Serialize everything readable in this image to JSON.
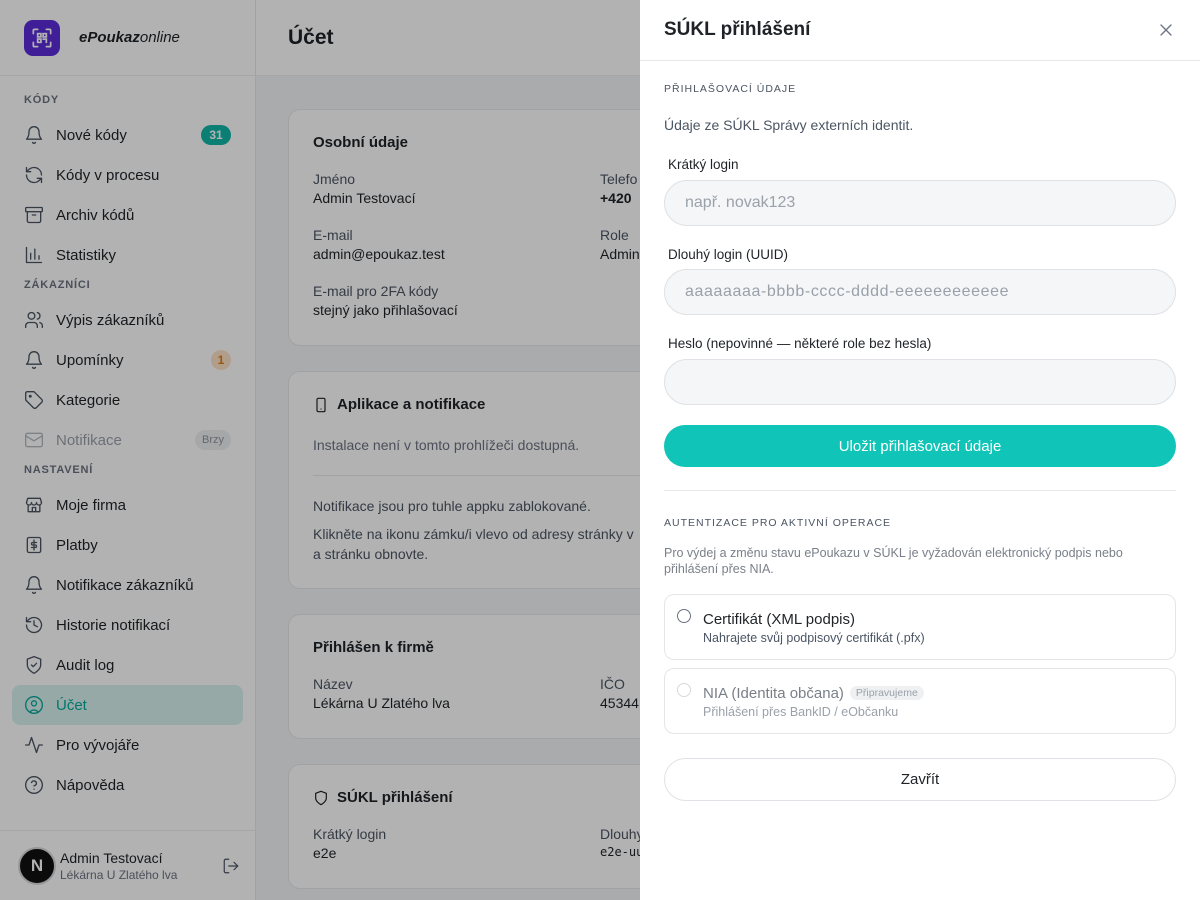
{
  "brand": {
    "name_bold": "ePoukaz",
    "name_italic": "online"
  },
  "nav": {
    "sections": {
      "codes": "KÓDY",
      "customers": "ZÁKAZNÍCI",
      "settings": "NASTAVENÍ"
    },
    "items": [
      {
        "label": "Nové kódy",
        "icon": "bell-icon",
        "badge": "31"
      },
      {
        "label": "Kódy v procesu",
        "icon": "refresh-icon"
      },
      {
        "label": "Archiv kódů",
        "icon": "archive-icon"
      },
      {
        "label": "Statistiky",
        "icon": "bar-chart-icon"
      },
      {
        "label": "Výpis zákazníků",
        "icon": "users-icon"
      },
      {
        "label": "Upomínky",
        "icon": "bell-icon",
        "badge": "1"
      },
      {
        "label": "Kategorie",
        "icon": "tag-icon"
      },
      {
        "label": "Notifikace",
        "icon": "mail-icon",
        "badge": "Brzy",
        "disabled": true
      },
      {
        "label": "Moje firma",
        "icon": "store-icon"
      },
      {
        "label": "Platby",
        "icon": "dollar-icon"
      },
      {
        "label": "Notifikace zákazníků",
        "icon": "bell-icon"
      },
      {
        "label": "Historie notifikací",
        "icon": "history-icon"
      },
      {
        "label": "Audit log",
        "icon": "shield-icon"
      },
      {
        "label": "Účet",
        "icon": "user-circle-icon",
        "active": true
      },
      {
        "label": "Pro vývojáře",
        "icon": "activity-icon"
      },
      {
        "label": "Nápověda",
        "icon": "help-icon"
      }
    ]
  },
  "user": {
    "initial": "N",
    "name": "Admin Testovací",
    "firm": "Lékárna U Zlatého lva"
  },
  "page": {
    "title": "Účet",
    "personal": {
      "title": "Osobní údaje",
      "name_label": "Jméno",
      "name_value": "Admin Testovací",
      "phone_label": "Telefo",
      "phone_value": "+420",
      "email_label": "E-mail",
      "email_value": "admin@epoukaz.test",
      "role_label": "Role",
      "role_value": "Admin",
      "email2fa_label": "E-mail pro 2FA kódy",
      "email2fa_value": "stejný jako přihlašovací"
    },
    "apps": {
      "title": "Aplikace a notifikace",
      "install_note": "Instalace není v tomto prohlížeči dostupná.",
      "blocked": "Notifikace jsou pro tuhle appku zablokované.",
      "hint_line1": "Klikněte na ikonu zámku/i vlevo od adresy stránky v",
      "hint_line2": "a stránku obnovte."
    },
    "firm": {
      "title": "Přihlášen k firmě",
      "name_label": "Název",
      "name_value": "Lékárna U Zlatého lva",
      "ico_label": "IČO",
      "ico_value": "45344"
    },
    "sukl": {
      "title": "SÚKL přihlášení",
      "short_label": "Krátký login",
      "short_value": "e2e",
      "long_label": "Dlouhy",
      "long_value": "e2e-uu"
    }
  },
  "drawer": {
    "title": "SÚKL přihlášení",
    "creds_caption": "PŘIHLAŠOVACÍ ÚDAJE",
    "creds_desc": "Údaje ze SÚKL Správy externích identit.",
    "short_label": "Krátký login",
    "short_placeholder": "např. novak123",
    "long_label": "Dlouhý login (UUID)",
    "long_placeholder": "aaaaaaaa-bbbb-cccc-dddd-eeeeeeeeeeee",
    "password_label": "Heslo (nepovinné — některé role bez hesla)",
    "password_placeholder": "",
    "save_label": "Uložit přihlašovací údaje",
    "auth_caption": "AUTENTIZACE PRO AKTIVNÍ OPERACE",
    "auth_desc": "Pro výdej a změnu stavu ePoukazu v SÚKL je vyžadován elektronický podpis nebo přihlášení přes NIA.",
    "options": [
      {
        "title": "Certifikát (XML podpis)",
        "subtitle": "Nahrajete svůj podpisový certifikát (.pfx)"
      },
      {
        "title": "NIA (Identita občana)",
        "tag": "Připravujeme",
        "subtitle": "Přihlášení přes BankID / eObčanku"
      }
    ],
    "close_label": "Zavřít"
  },
  "colors": {
    "accent": "#10c4b8",
    "brand": "#5b2bd8",
    "active_bg": "#d7f3f0",
    "warning": "#e07a14"
  }
}
